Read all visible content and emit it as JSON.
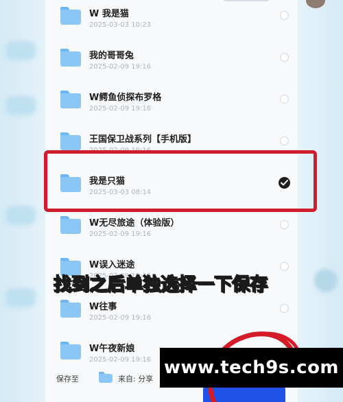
{
  "folders": [
    {
      "name": "W 我是猫",
      "date": "2025-03-03 10:23",
      "selected": false
    },
    {
      "name": "我的哥哥兔",
      "date": "2025-02-09 19:16",
      "selected": false
    },
    {
      "name": "W鳄鱼侦探布罗格",
      "date": "2025-02-09 19:16",
      "selected": false
    },
    {
      "name": "王国保卫战系列【手机版】",
      "date": "2025-02-09 19:16",
      "selected": false
    },
    {
      "name": "我是只猫",
      "date": "2025-03-03 08:14",
      "selected": true
    },
    {
      "name": "W无尽旅途（体验版）",
      "date": "2025-02-09 19:16",
      "selected": false
    },
    {
      "name": "W误入迷途",
      "date": "2025-02-09 19:16",
      "selected": false
    },
    {
      "name": "W往事",
      "date": "2025-02-09 19:16",
      "selected": false
    },
    {
      "name": "W午夜新娘",
      "date": "2025-02-09 19:16",
      "selected": false
    }
  ],
  "footer": {
    "save_to_label": "保存至",
    "source_label": "来自: 分享"
  },
  "caption": "找到之后单独选择一下保存",
  "watermark": "www.tech9s.com",
  "colors": {
    "highlight": "#cf1d2c",
    "caption_fill": "#f4dd4c",
    "folder": "#8cc6f4",
    "save_button": "#2052e8"
  }
}
